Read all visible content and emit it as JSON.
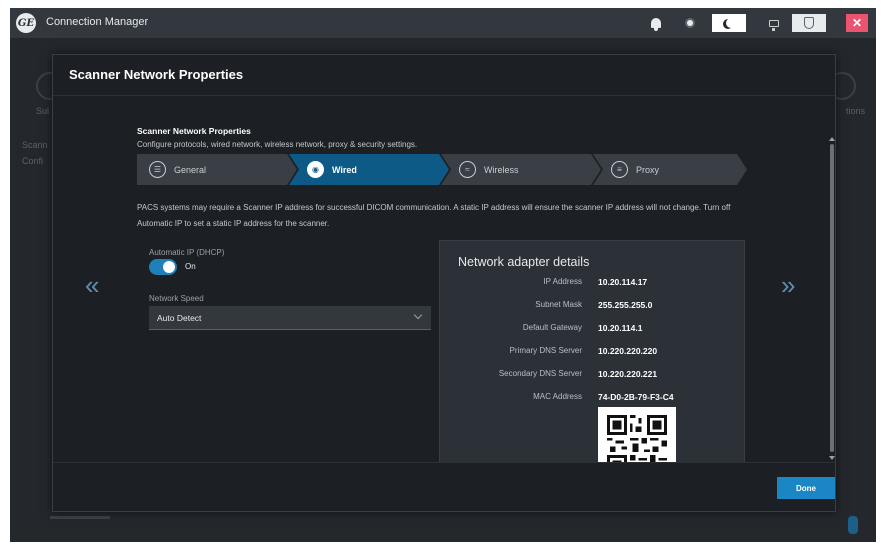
{
  "app": {
    "title": "Connection Manager",
    "logo_text": "GE"
  },
  "titlebar_icons": [
    "bell-icon",
    "sun-icon",
    "moon-icon",
    "monitor-icon",
    "shield-icon",
    "close-icon"
  ],
  "colors": {
    "accent": "#1b86c4",
    "active_step": "#0d5a87",
    "toggle_on": "#1f7fb8",
    "close": "#ea5470",
    "background": "#24282d",
    "dialog": "#1c1f23"
  },
  "background": {
    "left_labels": [
      "Sul",
      "Scann",
      "Confi"
    ],
    "right_label": "tions"
  },
  "dialog": {
    "title": "Scanner Network Properties",
    "section_title": "Scanner Network Properties",
    "section_subtitle": "Configure protocols, wired network, wireless network, proxy & security settings.",
    "steps": [
      {
        "label": "General",
        "icon": "list-icon",
        "active": false
      },
      {
        "label": "Wired",
        "icon": "globe-icon",
        "active": true
      },
      {
        "label": "Wireless",
        "icon": "wireless-icon",
        "active": false
      },
      {
        "label": "Proxy",
        "icon": "server-icon",
        "active": false
      }
    ],
    "info_text": "PACS systems may require a Scanner IP address for successful DICOM communication. A static IP address will ensure the scanner IP address will not change. Turn off Automatic IP to set a static IP address for the scanner.",
    "automatic_ip": {
      "label": "Automatic IP (DHCP)",
      "state": "On",
      "enabled": true
    },
    "network_speed": {
      "label": "Network Speed",
      "value": "Auto Detect"
    },
    "adapter": {
      "title": "Network adapter details",
      "rows": [
        {
          "label": "IP Address",
          "value": "10.20.114.17"
        },
        {
          "label": "Subnet Mask",
          "value": "255.255.255.0"
        },
        {
          "label": "Default Gateway",
          "value": "10.20.114.1"
        },
        {
          "label": "Primary DNS Server",
          "value": "10.220.220.220"
        },
        {
          "label": "Secondary DNS Server",
          "value": "10.220.220.221"
        },
        {
          "label": "MAC Address",
          "value": "74-D0-2B-79-F3-C4"
        }
      ]
    },
    "nav": {
      "prev": "«",
      "next": "»"
    },
    "done_label": "Done"
  }
}
